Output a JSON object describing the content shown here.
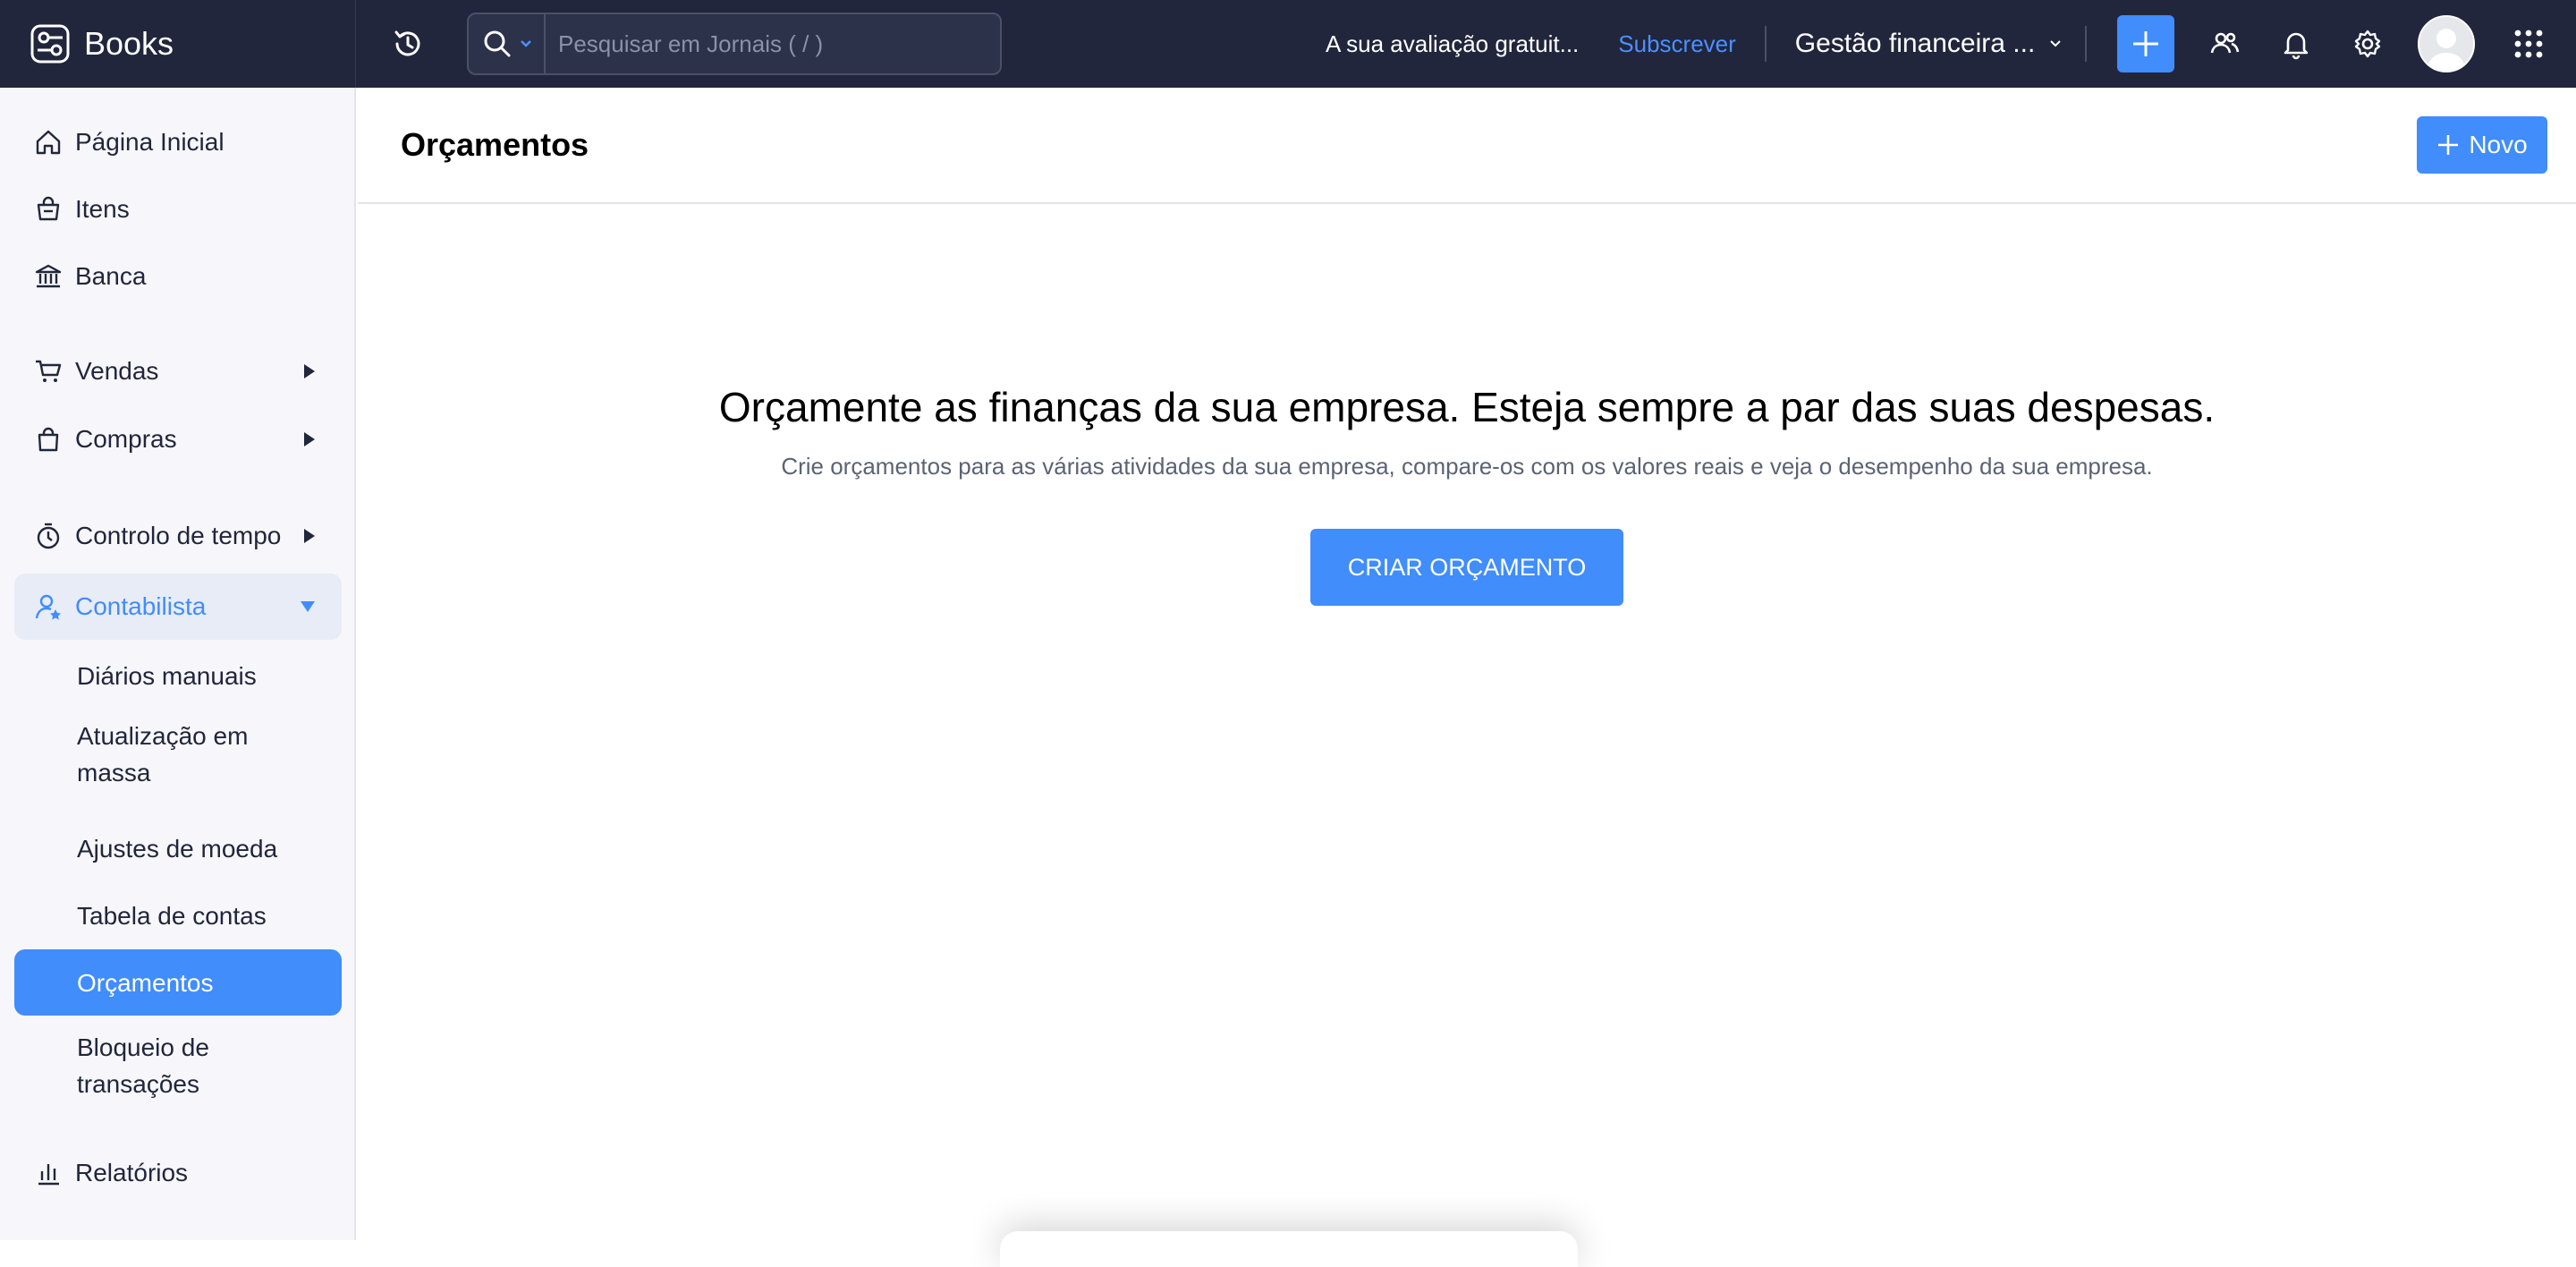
{
  "app": {
    "name": "Books"
  },
  "topbar": {
    "search_placeholder": "Pesquisar em Jornais ( / )",
    "trial_text": "A sua avaliação gratuit...",
    "subscribe_label": "Subscrever",
    "org_name": "Gestão financeira ..."
  },
  "sidebar": {
    "home": "Página Inicial",
    "items_label": "Itens",
    "banking": "Banca",
    "sales": "Vendas",
    "purchases": "Compras",
    "time_tracking": "Controlo de tempo",
    "accountant": "Contabilista",
    "sub": {
      "manual_journals": "Diários manuais",
      "bulk_update_1": "Atualização em",
      "bulk_update_2": "massa",
      "currency_adjustments": "Ajustes de moeda",
      "chart_of_accounts": "Tabela de contas",
      "budgets": "Orçamentos",
      "transaction_lock_1": "Bloqueio de",
      "transaction_lock_2": "transações"
    },
    "reports": "Relatórios"
  },
  "main": {
    "title": "Orçamentos",
    "new_label": "Novo",
    "empty_headline": "Orçamente as finanças da sua empresa. Esteja sempre a par das suas despesas.",
    "empty_desc": "Crie orçamentos para as várias atividades da sua empresa, compare-os com os valores reais e veja o desempenho da sua empresa.",
    "create_label": "CRIAR ORÇAMENTO"
  },
  "colors": {
    "topbar_bg": "#21263c",
    "accent": "#408dfb",
    "sidebar_bg": "#f7f7fb"
  }
}
